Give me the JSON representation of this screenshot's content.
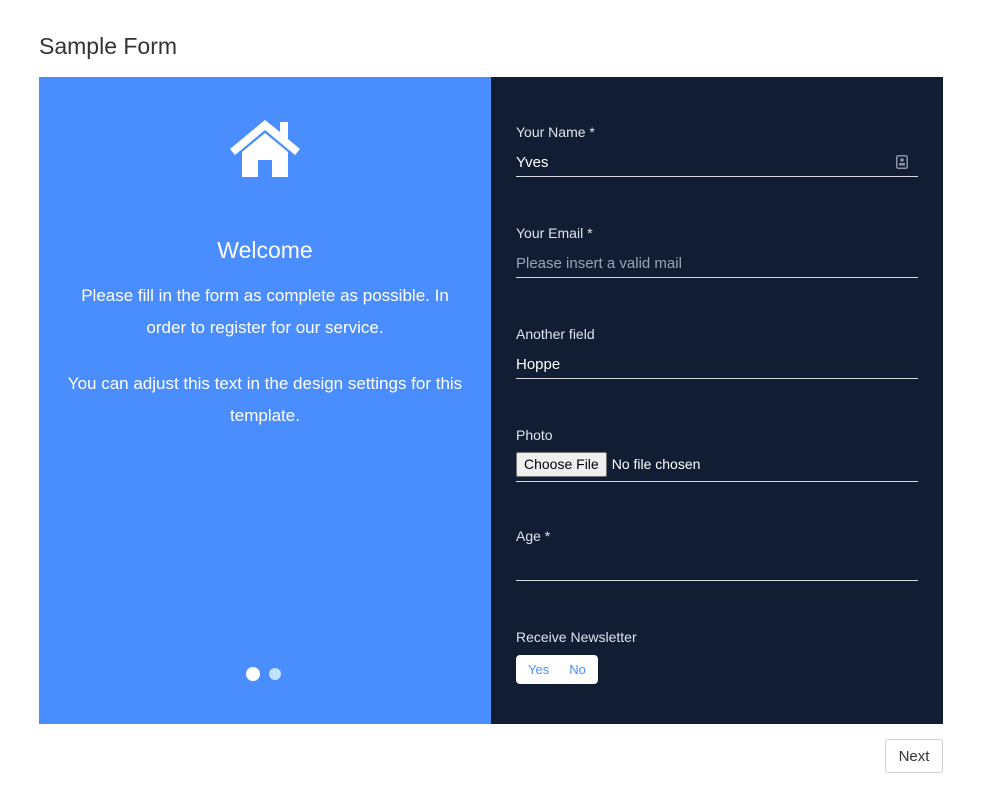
{
  "page": {
    "title": "Sample Form"
  },
  "intro_panel": {
    "icon": "home-icon",
    "heading": "Welcome",
    "paragraph_1": "Please fill in the form as complete as possible. In order to register for our service.",
    "paragraph_2": "You can adjust this text in the design settings for this template.",
    "pager": {
      "total": 2,
      "active": 1
    },
    "background_color": "#4a8dff"
  },
  "form": {
    "background_color": "#111d33",
    "fields": {
      "name": {
        "label": "Your Name *",
        "value": "Yves",
        "placeholder": ""
      },
      "email": {
        "label": "Your Email *",
        "value": "",
        "placeholder": "Please insert a valid mail"
      },
      "another": {
        "label": "Another field",
        "value": "Hoppe",
        "placeholder": ""
      },
      "photo": {
        "label": "Photo",
        "button_label": "Choose File",
        "status": "No file chosen"
      },
      "age": {
        "label": "Age *",
        "value": "",
        "placeholder": ""
      },
      "newsletter": {
        "label": "Receive Newsletter",
        "options": [
          "Yes",
          "No"
        ]
      }
    }
  },
  "footer": {
    "next_label": "Next"
  }
}
